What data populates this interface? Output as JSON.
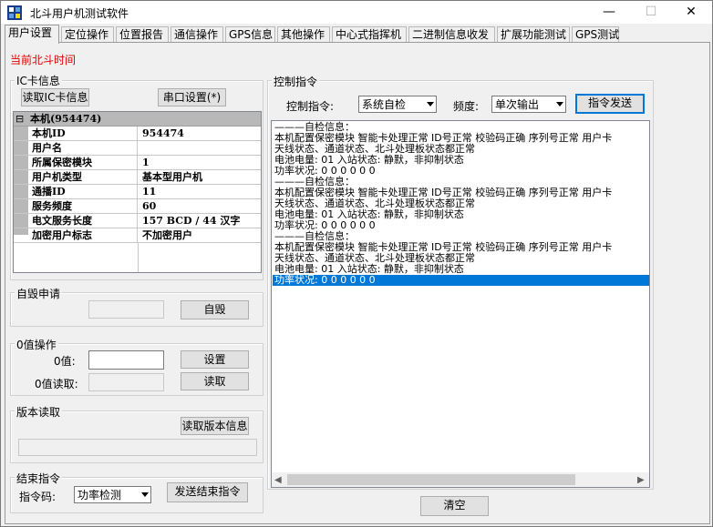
{
  "window": {
    "title": "北斗用户机测试软件",
    "minimize": "—",
    "maximize": "☐",
    "close": "✕"
  },
  "tabs": [
    "用户设置",
    "定位操作",
    "位置报告",
    "通信操作",
    "GPS信息",
    "其他操作",
    "中心式指挥机",
    "二进制信息收发",
    "扩展功能测试",
    "GPS测试"
  ],
  "beidou_time_label": "当前北斗时间",
  "ic_card": {
    "title": "IC卡信息",
    "read_button": "读取IC卡信息",
    "serial_button": "串口设置(*)",
    "header": "本机(954474)",
    "collapse": "⊟",
    "rows": [
      {
        "key": "本机ID",
        "value": "954474"
      },
      {
        "key": "用户名",
        "value": ""
      },
      {
        "key": "所属保密模块",
        "value": "1"
      },
      {
        "key": "用户机类型",
        "value": "基本型用户机"
      },
      {
        "key": "通播ID",
        "value": "11"
      },
      {
        "key": "服务频度",
        "value": "60"
      },
      {
        "key": "电文服务长度",
        "value": "157 BCD / 44 汉字"
      },
      {
        "key": "加密用户标志",
        "value": "不加密用户"
      }
    ]
  },
  "self_destruct": {
    "title": "自毁申请",
    "button": "自毁"
  },
  "zero_op": {
    "title": "0值操作",
    "zero_label": "0值:",
    "zero_read_label": "0值读取:",
    "set_button": "设置",
    "read_button": "读取"
  },
  "version": {
    "title": "版本读取",
    "button": "读取版本信息"
  },
  "end_cmd": {
    "title": "结束指令",
    "code_label": "指令码:",
    "code_value": "功率检测",
    "send_button": "发送结束指令"
  },
  "control": {
    "title": "控制指令",
    "cmd_label": "控制指令:",
    "cmd_value": "系统自检",
    "freq_label": "频度:",
    "freq_value": "单次输出",
    "send_button": "指令发送",
    "clear_button": "清空",
    "log_lines": [
      "———自检信息：",
      "本机配置保密模块 智能卡处理正常 ID号正常 校验码正确 序列号正常 用户卡",
      "天线状态、通道状态、北斗处理板状态都正常",
      "电池电量: 01  入站状态: 静默，非抑制状态",
      "功率状况: 0 0 0 0 0 0",
      "———自检信息：",
      "本机配置保密模块 智能卡处理正常 ID号正常 校验码正确 序列号正常 用户卡",
      "天线状态、通道状态、北斗处理板状态都正常",
      "电池电量: 01  入站状态: 静默，非抑制状态",
      "功率状况: 0 0 0 0 0 0",
      "———自检信息：",
      "本机配置保密模块 智能卡处理正常 ID号正常 校验码正确 序列号正常 用户卡",
      "天线状态、通道状态、北斗处理板状态都正常",
      "电池电量: 01  入站状态: 静默，非抑制状态",
      "功率状况: 0 0 0 0 0 0"
    ],
    "selected_index": 14
  },
  "colors": {
    "accent": "#0078d7",
    "time_label": "#e00000",
    "grid_header": "#b8b8b8"
  }
}
